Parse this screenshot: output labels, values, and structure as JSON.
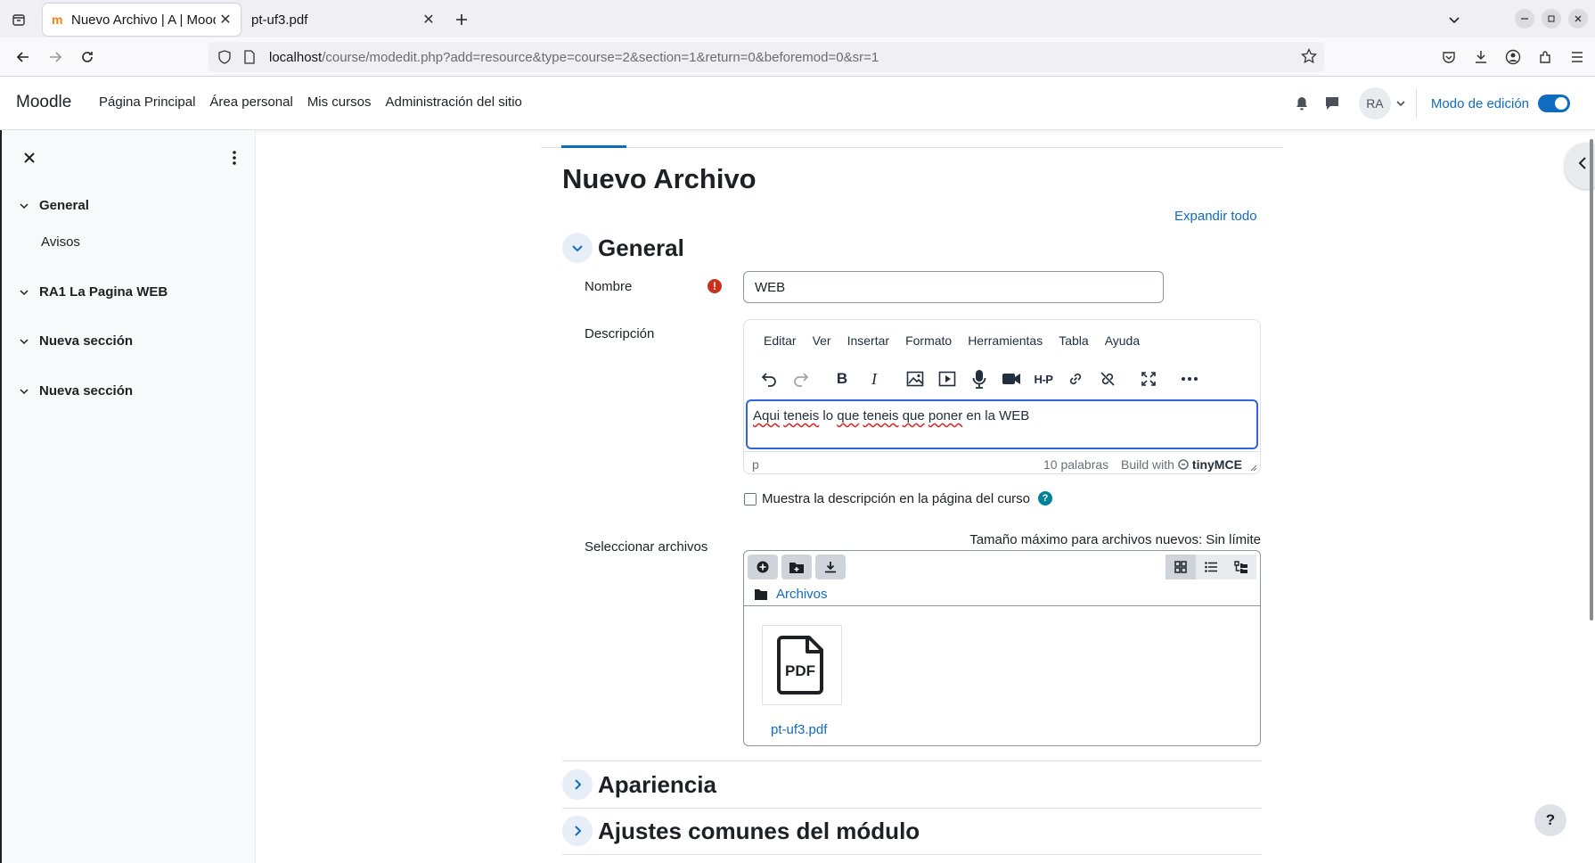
{
  "browser": {
    "tabs": [
      {
        "title": "Nuevo Archivo | A | Moodle",
        "active": true
      },
      {
        "title": "pt-uf3.pdf",
        "active": false
      }
    ],
    "url": {
      "host": "localhost",
      "path": "/course/modedit.php?add=resource&type=course=2&section=1&return=0&beforemod=0&sr=1"
    }
  },
  "moodle_nav": {
    "brand": "Moodle",
    "links": [
      "Página Principal",
      "Área personal",
      "Mis cursos",
      "Administración del sitio"
    ],
    "avatar_initials": "RA",
    "edit_mode_label": "Modo de edición",
    "edit_mode_on": true
  },
  "drawer": {
    "sections": [
      {
        "title": "General",
        "items": [
          "Avisos"
        ]
      },
      {
        "title": "RA1 La Pagina WEB",
        "items": []
      },
      {
        "title": "Nueva sección",
        "items": []
      },
      {
        "title": "Nueva sección",
        "items": []
      }
    ]
  },
  "page": {
    "title": "Nuevo Archivo",
    "expand_all": "Expandir todo"
  },
  "form": {
    "general_title": "General",
    "name_label": "Nombre",
    "name_value": "WEB",
    "description_label": "Descripción",
    "editor": {
      "menu": [
        "Editar",
        "Ver",
        "Insertar",
        "Formato",
        "Herramientas",
        "Tabla",
        "Ayuda"
      ],
      "content_words": [
        "Aqui",
        "teneis",
        "lo",
        "que",
        "teneis",
        "que",
        "poner",
        "en la WEB"
      ],
      "status_path": "p",
      "word_count": "10 palabras",
      "build_with": "Build with",
      "brand": "tinyMCE"
    },
    "show_description_label": "Muestra la descripción en la página del curso",
    "show_description_checked": false,
    "files_label": "Seleccionar archivos",
    "max_size": "Tamaño máximo para archivos nuevos: Sin límite",
    "folder_name": "Archivos",
    "file_name": "pt-uf3.pdf",
    "file_icon_text": "PDF",
    "collapsed_sections": [
      "Apariencia",
      "Ajustes comunes del módulo"
    ]
  },
  "help_button": "?",
  "colors": {
    "primary": "#0f6cbf",
    "required": "#ca3120",
    "help": "#008196"
  }
}
